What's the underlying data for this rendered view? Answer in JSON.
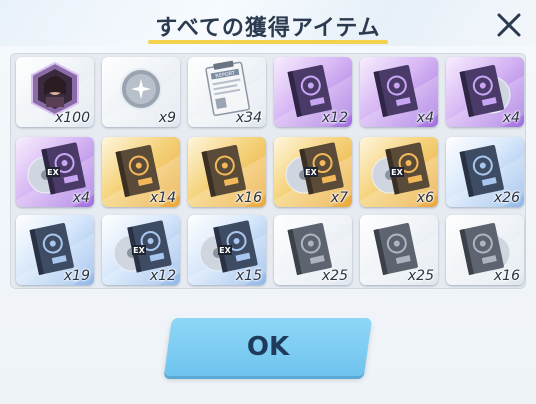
{
  "dialog": {
    "title": "すべての獲得アイテム",
    "ok_label": "OK"
  },
  "colors": {
    "accent_underline": "#f4d24c",
    "ok_button": "#7fcdf3"
  },
  "items": [
    {
      "kind": "portrait-badge",
      "rarity": "white",
      "count": "x100"
    },
    {
      "kind": "silver-orb",
      "rarity": "white",
      "count": "x9"
    },
    {
      "kind": "report",
      "rarity": "white",
      "count": "x34"
    },
    {
      "kind": "book",
      "rarity": "purple",
      "count": "x12"
    },
    {
      "kind": "book",
      "rarity": "purple",
      "count": "x4"
    },
    {
      "kind": "book-disc",
      "rarity": "purple",
      "count": "x4"
    },
    {
      "kind": "disc-ex",
      "rarity": "purple",
      "count": "x4"
    },
    {
      "kind": "book",
      "rarity": "gold",
      "count": "x14"
    },
    {
      "kind": "book",
      "rarity": "gold",
      "count": "x16"
    },
    {
      "kind": "disc-ex",
      "rarity": "gold",
      "count": "x7"
    },
    {
      "kind": "disc-ex",
      "rarity": "gold",
      "count": "x6"
    },
    {
      "kind": "book",
      "rarity": "blue",
      "count": "x26"
    },
    {
      "kind": "book",
      "rarity": "blue",
      "count": "x19"
    },
    {
      "kind": "disc-ex",
      "rarity": "blue",
      "count": "x12"
    },
    {
      "kind": "disc-ex",
      "rarity": "blue",
      "count": "x15"
    },
    {
      "kind": "book",
      "rarity": "white",
      "count": "x25"
    },
    {
      "kind": "book",
      "rarity": "white",
      "count": "x25"
    },
    {
      "kind": "book-disc",
      "rarity": "white",
      "count": "x16"
    }
  ]
}
